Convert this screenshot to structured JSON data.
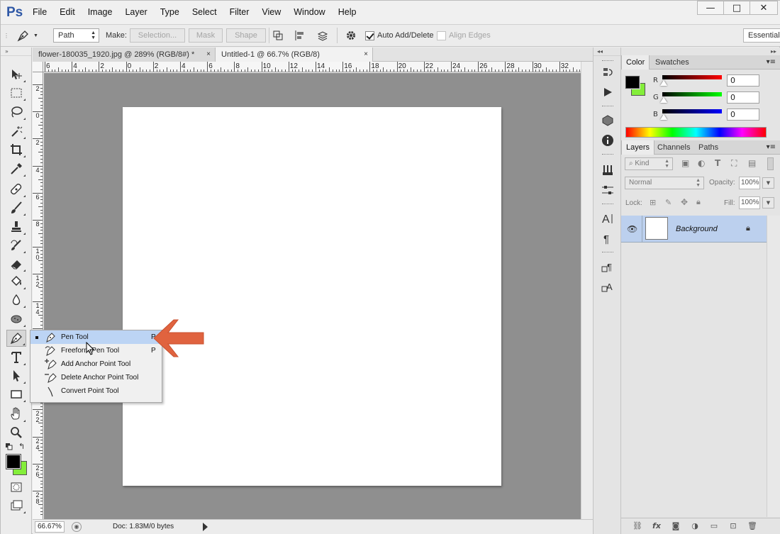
{
  "app": {
    "logo": "Ps"
  },
  "menubar": {
    "items": [
      "File",
      "Edit",
      "Image",
      "Layer",
      "Type",
      "Select",
      "Filter",
      "View",
      "Window",
      "Help"
    ]
  },
  "window_controls": {
    "minimize": "—",
    "maximize": "□",
    "close": "✕"
  },
  "options_bar": {
    "mode_select": "Path",
    "make_label": "Make:",
    "selection_button": "Selection...",
    "mask_button": "Mask",
    "shape_button": "Shape",
    "auto_add_delete_label": "Auto Add/Delete",
    "auto_add_delete_checked": true,
    "align_edges_label": "Align Edges",
    "align_edges_checked": false,
    "workspace": "Essentials"
  },
  "documents": {
    "tabs": [
      {
        "title": "flower-180035_1920.jpg @ 289% (RGB/8#) *",
        "close": "×",
        "active": false
      },
      {
        "title": "Untitled-1 @ 66.7% (RGB/8)",
        "close": "×",
        "active": true
      }
    ]
  },
  "rulers": {
    "horizontal": [
      "6",
      "4",
      "2",
      "0",
      "2",
      "4",
      "6",
      "8",
      "10",
      "12",
      "14",
      "16",
      "18",
      "20",
      "22",
      "24",
      "26",
      "28",
      "30",
      "32"
    ],
    "vertical": [
      "2",
      "0",
      "2",
      "4",
      "6",
      "8",
      "1 0",
      "1 2",
      "1 4",
      "1 6",
      "1 8",
      "2 0",
      "2 2",
      "2 4",
      "2 6",
      "2 8"
    ]
  },
  "status_bar": {
    "zoom": "66.67%",
    "doc_info": "Doc: 1.83M/0 bytes"
  },
  "tool_flyout": {
    "items": [
      {
        "label": "Pen Tool",
        "shortcut": "P",
        "selected": true,
        "icon": "pen-icon"
      },
      {
        "label": "Freeform Pen Tool",
        "shortcut": "P",
        "selected": false,
        "icon": "freeform-pen-icon"
      },
      {
        "label": "Add Anchor Point Tool",
        "shortcut": "",
        "selected": false,
        "icon": "add-anchor-icon"
      },
      {
        "label": "Delete Anchor Point Tool",
        "shortcut": "",
        "selected": false,
        "icon": "delete-anchor-icon"
      },
      {
        "label": "Convert Point Tool",
        "shortcut": "",
        "selected": false,
        "icon": "convert-point-icon"
      }
    ]
  },
  "color_panel": {
    "tabs": [
      "Color",
      "Swatches"
    ],
    "channels": [
      {
        "label": "R",
        "value": "0",
        "color": "#ff0000"
      },
      {
        "label": "G",
        "value": "0",
        "color": "#00ff00"
      },
      {
        "label": "B",
        "value": "0",
        "color": "#0000ff"
      }
    ],
    "foreground": "#000000",
    "background": "#84ee3a"
  },
  "layers_panel": {
    "tabs": [
      "Layers",
      "Channels",
      "Paths"
    ],
    "kind_filter": "Kind",
    "blend_mode": "Normal",
    "opacity_label": "Opacity:",
    "opacity": "100%",
    "lock_label": "Lock:",
    "fill_label": "Fill:",
    "fill": "100%",
    "layers": [
      {
        "name": "Background",
        "locked": true,
        "visible": true
      }
    ]
  },
  "accent": {
    "arrow": "#e0633f",
    "selection": "#bcd4f4"
  }
}
